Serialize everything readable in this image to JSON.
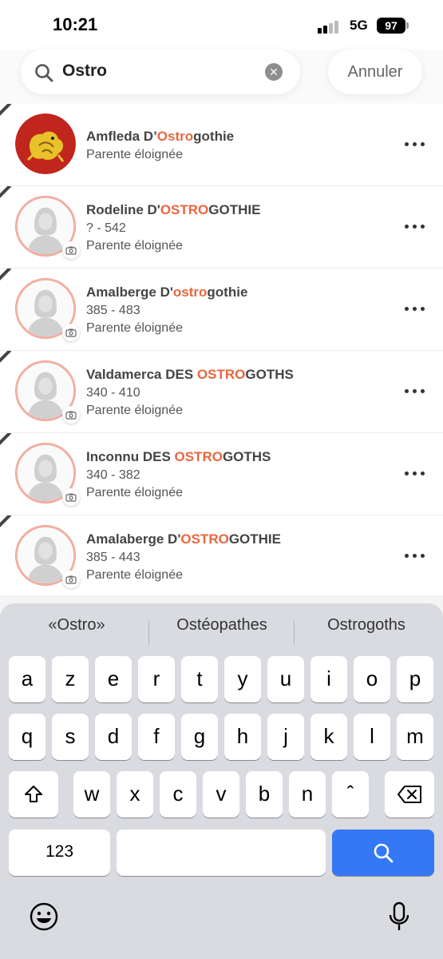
{
  "status": {
    "time": "10:21",
    "network": "5G",
    "battery": "97"
  },
  "search": {
    "query": "Ostro",
    "cancel_label": "Annuler"
  },
  "results": [
    {
      "name_pre": "Amfleda D’",
      "name_hl": "Ostro",
      "name_post": "gothie",
      "dates": "",
      "relation": "Parente éloignée",
      "has_photo": true
    },
    {
      "name_pre": "Rodeline D'",
      "name_hl": "OSTRO",
      "name_post": "GOTHIE",
      "dates": "? - 542",
      "relation": "Parente éloignée",
      "has_photo": false
    },
    {
      "name_pre": "Amalberge D'",
      "name_hl": "ostro",
      "name_post": "gothie",
      "dates": "385 - 483",
      "relation": "Parente éloignée",
      "has_photo": false
    },
    {
      "name_pre": "Valdamerca DES ",
      "name_hl": "OSTRO",
      "name_post": "GOTHS",
      "dates": "340 - 410",
      "relation": "Parente éloignée",
      "has_photo": false
    },
    {
      "name_pre": "Inconnu DES ",
      "name_hl": "OSTRO",
      "name_post": "GOTHS",
      "dates": "340 - 382",
      "relation": "Parente éloignée",
      "has_photo": false
    },
    {
      "name_pre": "Amalaberge D'",
      "name_hl": "OSTRO",
      "name_post": "GOTHIE",
      "dates": "385 - 443",
      "relation": "Parente éloignée",
      "has_photo": false
    }
  ],
  "keyboard": {
    "suggestions": [
      "«Ostro»",
      "Ostéopathes",
      "Ostrogoths"
    ],
    "row1": [
      "a",
      "z",
      "e",
      "r",
      "t",
      "y",
      "u",
      "i",
      "o",
      "p"
    ],
    "row2": [
      "q",
      "s",
      "d",
      "f",
      "g",
      "h",
      "j",
      "k",
      "l",
      "m"
    ],
    "row3": [
      "w",
      "x",
      "c",
      "v",
      "b",
      "n",
      "ˆ"
    ],
    "numbers_label": "123"
  },
  "colors": {
    "highlight": "#e8663e",
    "search_key": "#3478f6"
  }
}
